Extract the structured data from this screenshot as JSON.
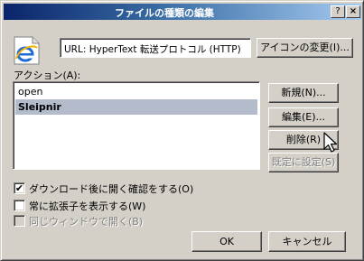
{
  "window": {
    "title": "ファイルの種類の編集",
    "help_glyph": "?",
    "close_glyph": "×"
  },
  "file_type": {
    "icon": "internet-explorer-icon",
    "description": "URL: HyperText 転送プロトコル (HTTP)"
  },
  "buttons": {
    "change_icon": "アイコンの変更(I)...",
    "new": "新規(N)...",
    "edit": "編集(E)...",
    "remove": "削除(R)",
    "set_default": "既定に設定(S)",
    "ok": "OK",
    "cancel": "キャンセル"
  },
  "actions": {
    "label": "アクション(A):",
    "items": [
      {
        "label": "open",
        "selected": false
      },
      {
        "label": "Sleipnir",
        "selected": true
      }
    ]
  },
  "options": [
    {
      "label": "ダウンロード後に開く確認をする(O)",
      "checked": true,
      "enabled": true,
      "mark": "✔"
    },
    {
      "label": "常に拡張子を表示する(W)",
      "checked": false,
      "enabled": true,
      "mark": ""
    },
    {
      "label": "同じウィンドウで開く(B)",
      "checked": false,
      "enabled": false,
      "mark": ""
    }
  ],
  "colors": {
    "title_start": "#0a246a",
    "title_end": "#a6caf0",
    "selection": "#b4bccc",
    "face": "#d4d0c8"
  }
}
